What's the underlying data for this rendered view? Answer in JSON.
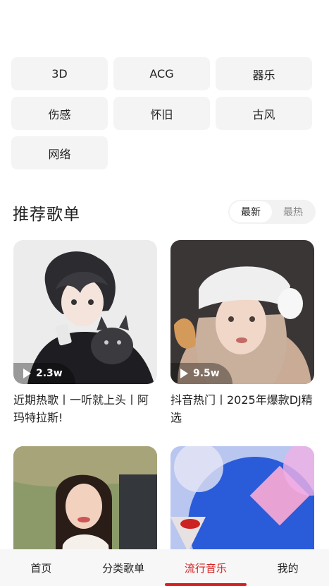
{
  "category_tags": [
    {
      "label": "3D"
    },
    {
      "label": "ACG"
    },
    {
      "label": "器乐"
    },
    {
      "label": "伤感"
    },
    {
      "label": "怀旧"
    },
    {
      "label": "古风"
    },
    {
      "label": "网络"
    }
  ],
  "recommend": {
    "title": "推荐歌单",
    "sort_options": [
      "最新",
      "最热"
    ],
    "selected_sort": "最新"
  },
  "playlists": [
    {
      "title": "近期热歌丨一听就上头丨阿玛特拉斯!",
      "play_count": "2.3w"
    },
    {
      "title": "抖音热门丨2025年爆款DJ精选",
      "play_count": "9.5w"
    },
    {
      "title": "",
      "play_count": ""
    },
    {
      "title": "",
      "play_count": ""
    }
  ],
  "tabbar": {
    "items": [
      "首页",
      "分类歌单",
      "流行音乐",
      "我的"
    ],
    "active": "流行音乐"
  },
  "colors": {
    "accent": "#d81e1e",
    "tag_bg": "#f4f4f4"
  }
}
